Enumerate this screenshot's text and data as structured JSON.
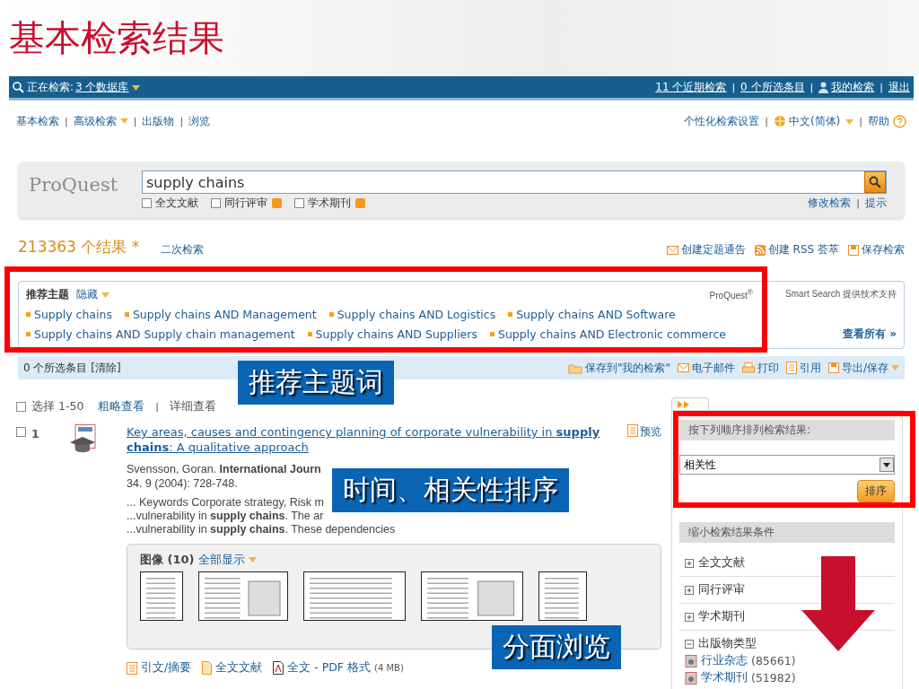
{
  "slide_title": "基本检索结果",
  "top_bar": {
    "searching_label": "正在检索:",
    "databases_link": "3 个数据库",
    "links": [
      {
        "label": "11 个近期检索",
        "kind": "link"
      },
      {
        "separator": "|",
        "label": "0 个所选条目",
        "kind": "link"
      },
      {
        "separator": "|",
        "label": "我的检索",
        "kind": "user"
      },
      {
        "separator": "|",
        "label": "退出",
        "kind": "link"
      }
    ]
  },
  "nav": {
    "left": [
      {
        "label": "基本检索",
        "dropdown": false
      },
      {
        "separator": "|",
        "label": "高级检索",
        "dropdown": true
      },
      {
        "separator": "|",
        "label": "出版物",
        "dropdown": false
      },
      {
        "separator": "|",
        "label": "浏览",
        "dropdown": false
      }
    ],
    "right": [
      {
        "label": "个性化检索设置",
        "kind": "link"
      },
      {
        "separator": "|",
        "label": "中文(简体)",
        "kind": "language"
      },
      {
        "separator": "|",
        "label": "帮助",
        "kind": "help"
      }
    ]
  },
  "search": {
    "logo": "ProQuest",
    "value": "supply chains",
    "filters": [
      {
        "label": "全文文献",
        "checked": false,
        "info": false
      },
      {
        "label": "同行评审",
        "checked": false,
        "info": true
      },
      {
        "label": "学术期刊",
        "checked": false,
        "info": true
      }
    ],
    "links": [
      {
        "label": "修改检索"
      },
      {
        "separator": "|",
        "label": "提示"
      }
    ]
  },
  "results_header": {
    "count": "213363 个结果 *",
    "refine": "二次检索",
    "actions": [
      {
        "label": "创建定题通告",
        "kind": "mail"
      },
      {
        "label": "创建 RSS 荟萃",
        "kind": "rss"
      },
      {
        "label": "保存检索",
        "kind": "save"
      }
    ]
  },
  "suggested": {
    "title": "推荐主题",
    "toggle": "隐藏",
    "powered_brand": "ProQuest$^{®}$",
    "powered_text": "Smart Search 提供技术支持",
    "see_all": "查看所有 »",
    "lines": [
      {
        "topics": [
          "Supply chains",
          "Supply chains AND Management",
          "Supply chains AND Logistics",
          "Supply chains AND Software"
        ]
      },
      {
        "topics": [
          "Supply chains AND Supply chain management",
          "Supply chains AND Suppliers",
          "Supply chains AND Electronic commerce"
        ]
      }
    ]
  },
  "selection_bar": {
    "label": "0 个所选条目 [清除]",
    "actions": [
      {
        "label": "保存到\"我的检索\"",
        "kind": "folder"
      },
      {
        "label": "电子邮件",
        "kind": "mail"
      },
      {
        "label": "打印",
        "kind": "print"
      },
      {
        "label": "引用",
        "kind": "cite"
      },
      {
        "label": "导出/保存",
        "kind": "save"
      }
    ]
  },
  "list_header": {
    "select": "选择 1-50",
    "checked": false,
    "views": [
      {
        "label": "粗略查看",
        "selected": false
      },
      {
        "separator": "|",
        "label": "详细查看",
        "selected": true
      }
    ]
  },
  "results": [
    {
      "number": "1",
      "checked": false,
      "title": "Key areas, causes and contingency planning of corporate vulnerability in **supply chains**: A qualitative approach",
      "preview": "预览",
      "author": "Svensson, Goran. **International Journ**",
      "citation": "34. 9 (2004): 728-748.",
      "snippets": [
        "... Keywords Corporate strategy, Risk m",
        "...vulnerability in **supply chains**. The ar",
        "...vulnerability in **supply chains**. These dependencies"
      ],
      "images": {
        "title": "图像 (10)",
        "show_all": "全部显示"
      },
      "links": [
        {
          "label": "引文/摘要",
          "kind": "abstract"
        },
        {
          "label": "全文文献",
          "kind": "fulltext"
        },
        {
          "label": "全文 - PDF 格式",
          "kind": "pdf",
          "size": "(4 MB)"
        }
      ]
    }
  ],
  "sidebar": {
    "sort_title": "按下列顺序排列检索结果:",
    "sort_value": "相关性",
    "sort_button": "排序",
    "narrow_title": "缩小检索结果条件",
    "facets": [
      {
        "label": "全文文献",
        "expanded": false
      },
      {
        "label": "同行评审",
        "expanded": false
      },
      {
        "label": "学术期刊",
        "expanded": false
      },
      {
        "label": "出版物类型",
        "expanded": true,
        "children": [
          {
            "label": "行业杂志",
            "count": "(85661)"
          },
          {
            "label": "学术期刊",
            "count": "(51982)"
          }
        ]
      }
    ]
  },
  "annotations": [
    {
      "text": "推荐主题词"
    },
    {
      "text": "时间、相关性排序"
    },
    {
      "text": "分面浏览"
    }
  ]
}
